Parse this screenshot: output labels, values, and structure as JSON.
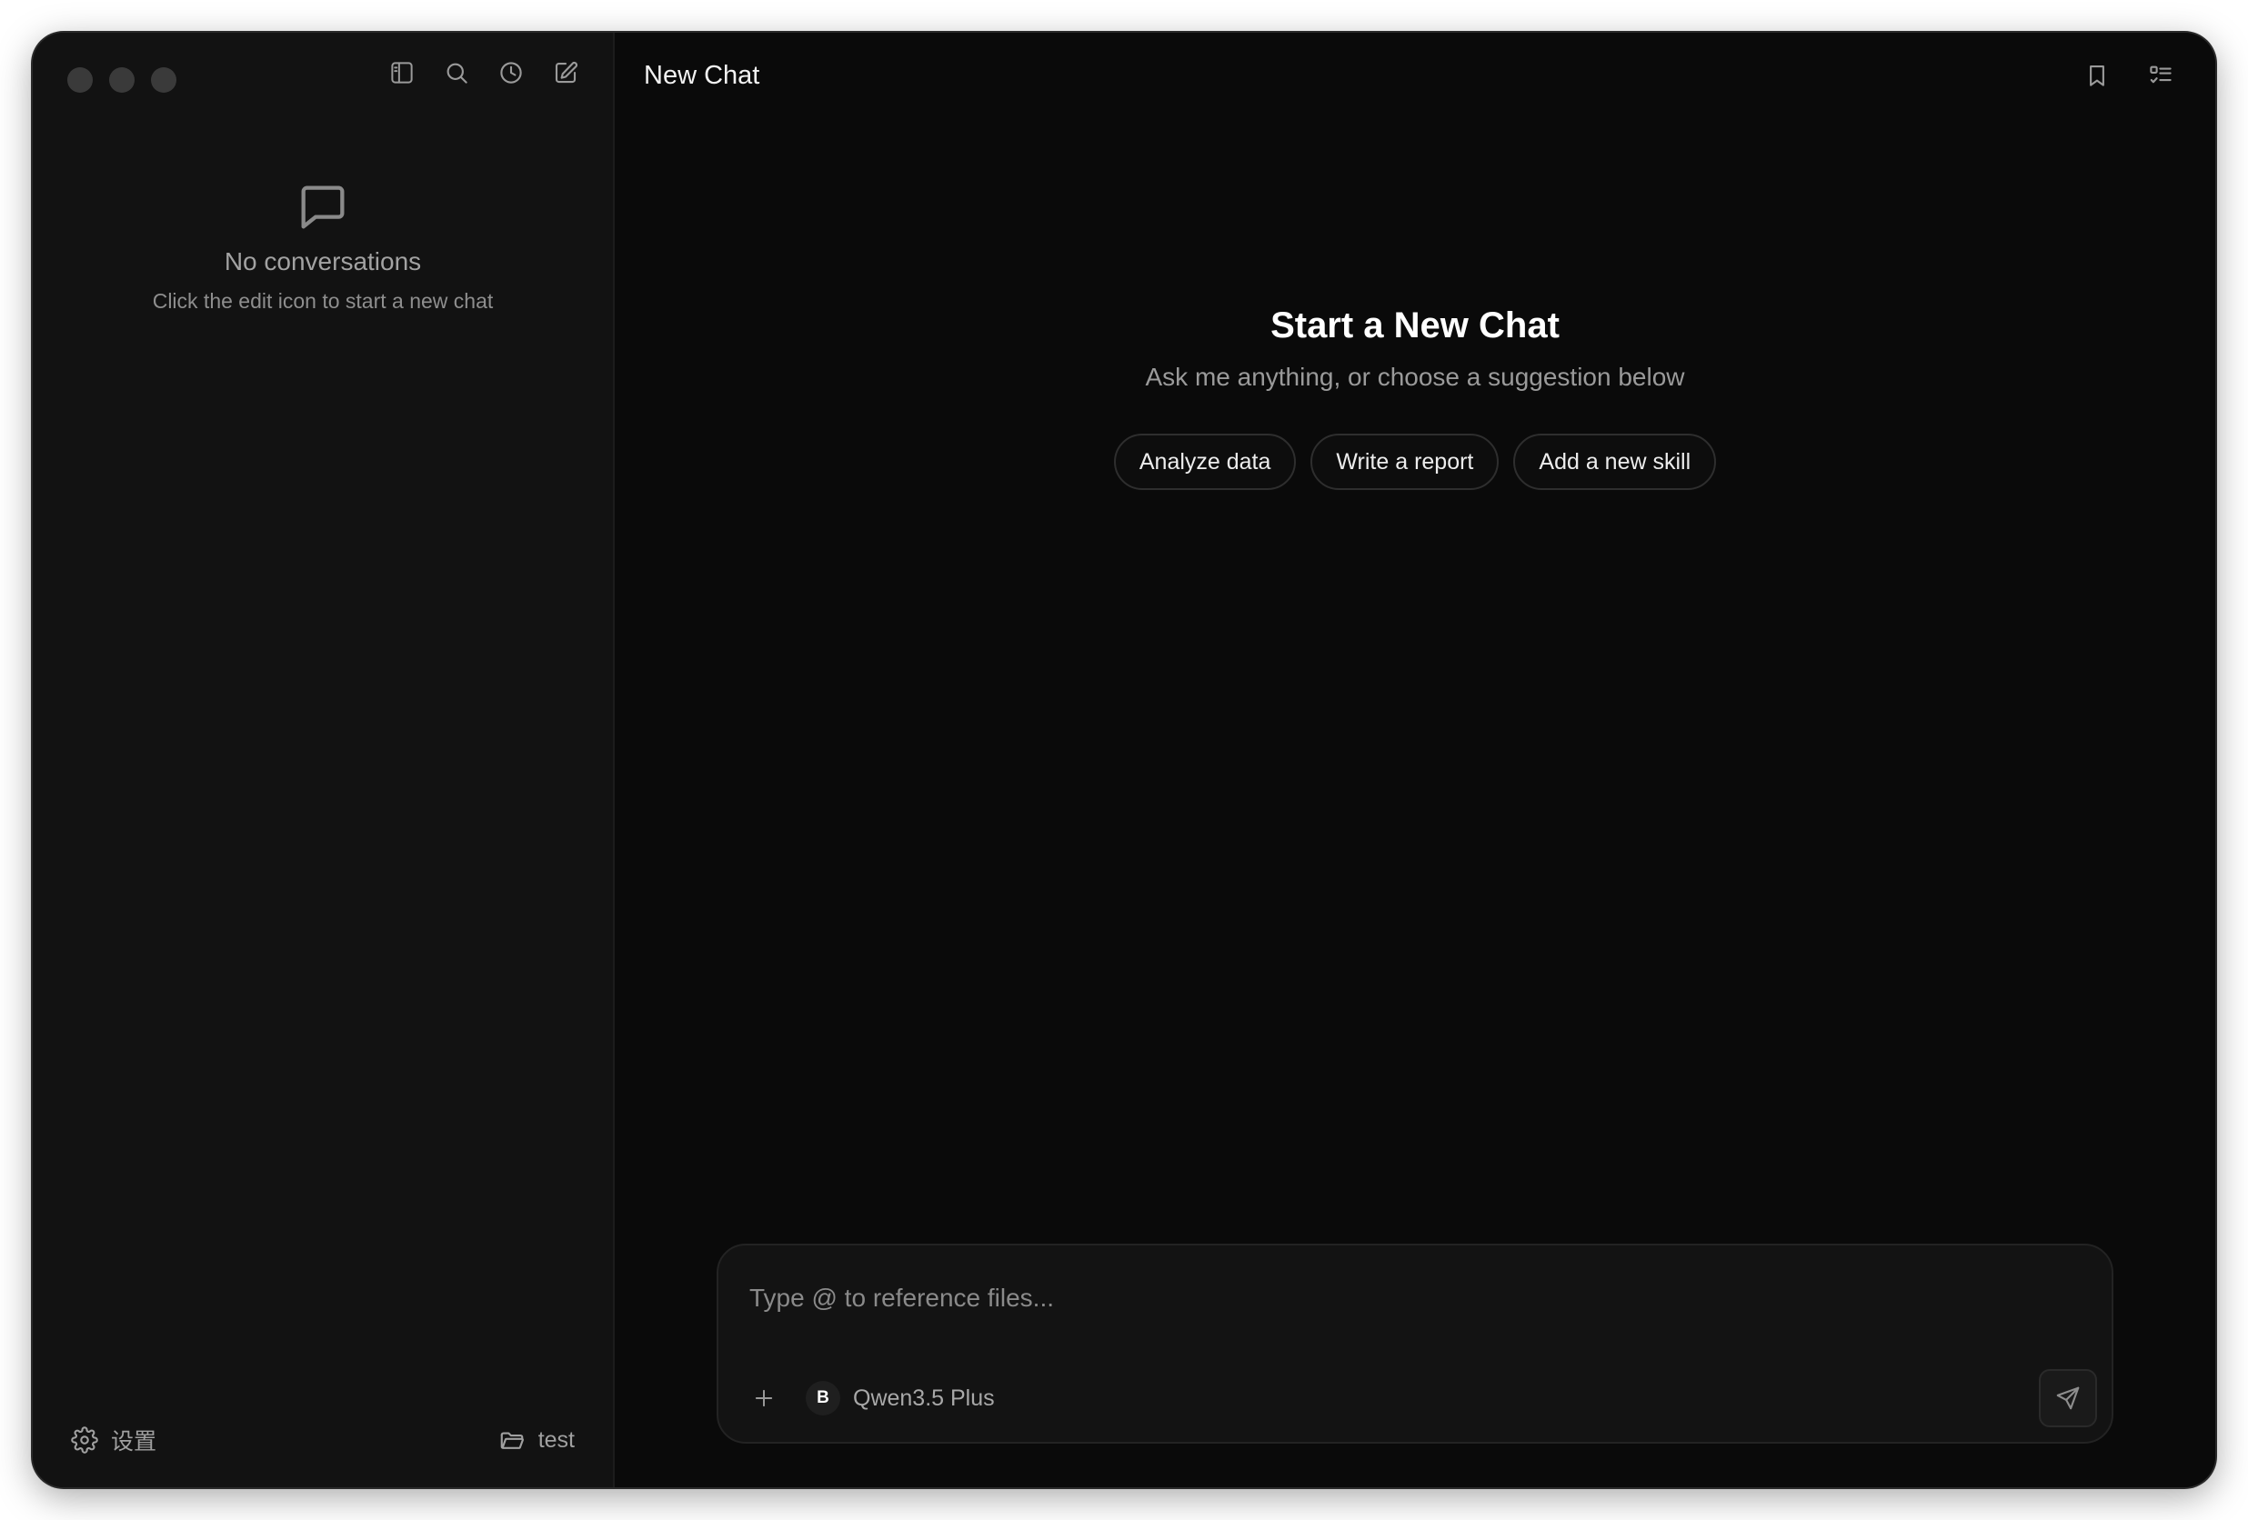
{
  "window": {
    "traffic_lights": [
      "close",
      "minimize",
      "zoom"
    ]
  },
  "sidebar": {
    "toolbar": [
      {
        "icon": "sidebar-toggle-icon",
        "action": "toggle-sidebar"
      },
      {
        "icon": "search-icon",
        "action": "search"
      },
      {
        "icon": "history-icon",
        "action": "history"
      },
      {
        "icon": "edit-icon",
        "action": "new-chat"
      }
    ],
    "empty_state": {
      "icon": "chat-bubble-icon",
      "title": "No conversations",
      "subtitle": "Click the edit icon to start a new chat"
    },
    "footer": {
      "settings_label": "设置",
      "settings_icon": "gear-icon",
      "workspace_label": "test",
      "workspace_icon": "folder-icon"
    }
  },
  "header": {
    "title": "New Chat",
    "actions": [
      {
        "icon": "bookmark-icon"
      },
      {
        "icon": "checklist-icon"
      }
    ]
  },
  "welcome": {
    "title": "Start a New Chat",
    "subtitle": "Ask me anything, or choose a suggestion below",
    "suggestions": [
      "Analyze data",
      "Write a report",
      "Add a new skill"
    ]
  },
  "composer": {
    "placeholder": "Type @ to reference files...",
    "value": "",
    "model": {
      "badge": "B",
      "name": "Qwen3.5 Plus"
    },
    "attach_icon": "plus-icon",
    "send_icon": "send-icon"
  },
  "colors": {
    "window_bg": "#0a0a0a",
    "sidebar_bg": "#121212",
    "text_primary": "#ffffff",
    "text_secondary": "#9a9a9a",
    "border": "#2e2e2e"
  }
}
